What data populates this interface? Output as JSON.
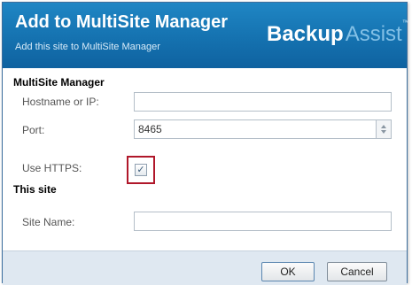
{
  "header": {
    "title": "Add to MultiSite Manager",
    "subtitle": "Add this site to MultiSite Manager",
    "logo_main": "Backup",
    "logo_accent": "Assist",
    "logo_tm": "™"
  },
  "multisite": {
    "heading": "MultiSite Manager",
    "hostname_label": "Hostname or IP:",
    "hostname_value": "",
    "port_label": "Port:",
    "port_value": "8465",
    "https_label": "Use HTTPS:",
    "https_checked": true,
    "check_glyph": "✓"
  },
  "site": {
    "heading": "This site",
    "name_label": "Site Name:",
    "name_value": ""
  },
  "buttons": {
    "ok": "OK",
    "cancel": "Cancel"
  },
  "icons": {
    "spin": "spinner-arrows-icon"
  },
  "colors": {
    "header_blue": "#1470ae",
    "highlight_red": "#b0172a",
    "footer_bg": "#dfe8f1"
  }
}
